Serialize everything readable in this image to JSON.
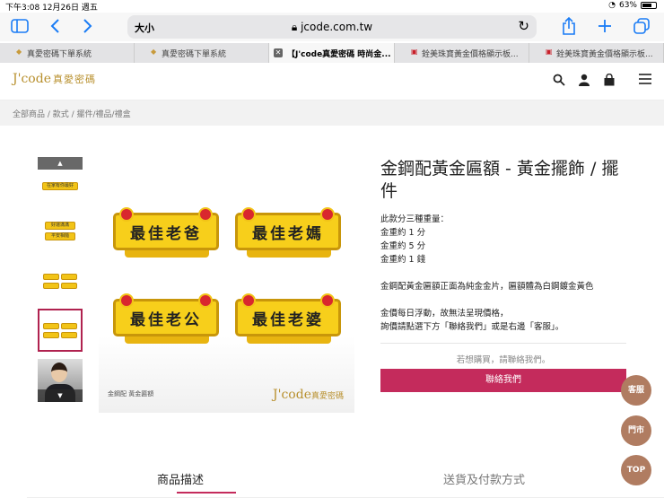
{
  "status": {
    "time_date": "下午3:08   12月26日 週五",
    "battery": "63%"
  },
  "browser": {
    "text_size": "大小",
    "address": "jcode.com.tw",
    "tabs": [
      {
        "label": "真愛密碼下單系統"
      },
      {
        "label": "真愛密碼下單系統"
      },
      {
        "label": "【J'code真愛密碼 時尚金..."
      },
      {
        "label": "銓美珠寶黃金價格顯示板..."
      },
      {
        "label": "銓美珠寶黃金價格顯示板..."
      }
    ]
  },
  "site": {
    "logo_brand": "J'code",
    "logo_cn": "真愛密碼",
    "breadcrumb": "全部商品 / 款式 / 擺件/禮品/禮盒"
  },
  "product": {
    "title": "金鋼配黃金匾額 - 黃金擺飾 / 擺件",
    "desc_lines": [
      "此款分三種重量：",
      "金重約 1 分",
      "金重約 5 分",
      "金重約 1 錢"
    ],
    "desc_material": "金鋼配黃金匾額正面為純金金片，匾額體為白鋼鍍金黃色",
    "desc_price_1": "金價每日浮動，故無法呈現價格，",
    "desc_price_2": "詢價請點選下方「聯絡我們」或是右邊「客服」。",
    "purchase_note": "若想購買，請聯絡我們。",
    "contact_button": "聯絡我們",
    "image": {
      "plaques": [
        "最佳老爸",
        "最佳老媽",
        "最佳老公",
        "最佳老婆"
      ],
      "caption_left": "金鋼配 黃金匾額",
      "caption_brand": "J'code",
      "caption_brand_cn": "真愛密碼"
    },
    "thumb_texts": [
      "在家有你最好",
      "好運滿滿",
      "平安相隨"
    ]
  },
  "floating": {
    "service": "客服",
    "stores": "門市",
    "top": "TOP"
  },
  "product_tabs": {
    "description": "商品描述",
    "shipping": "送貨及付款方式"
  }
}
